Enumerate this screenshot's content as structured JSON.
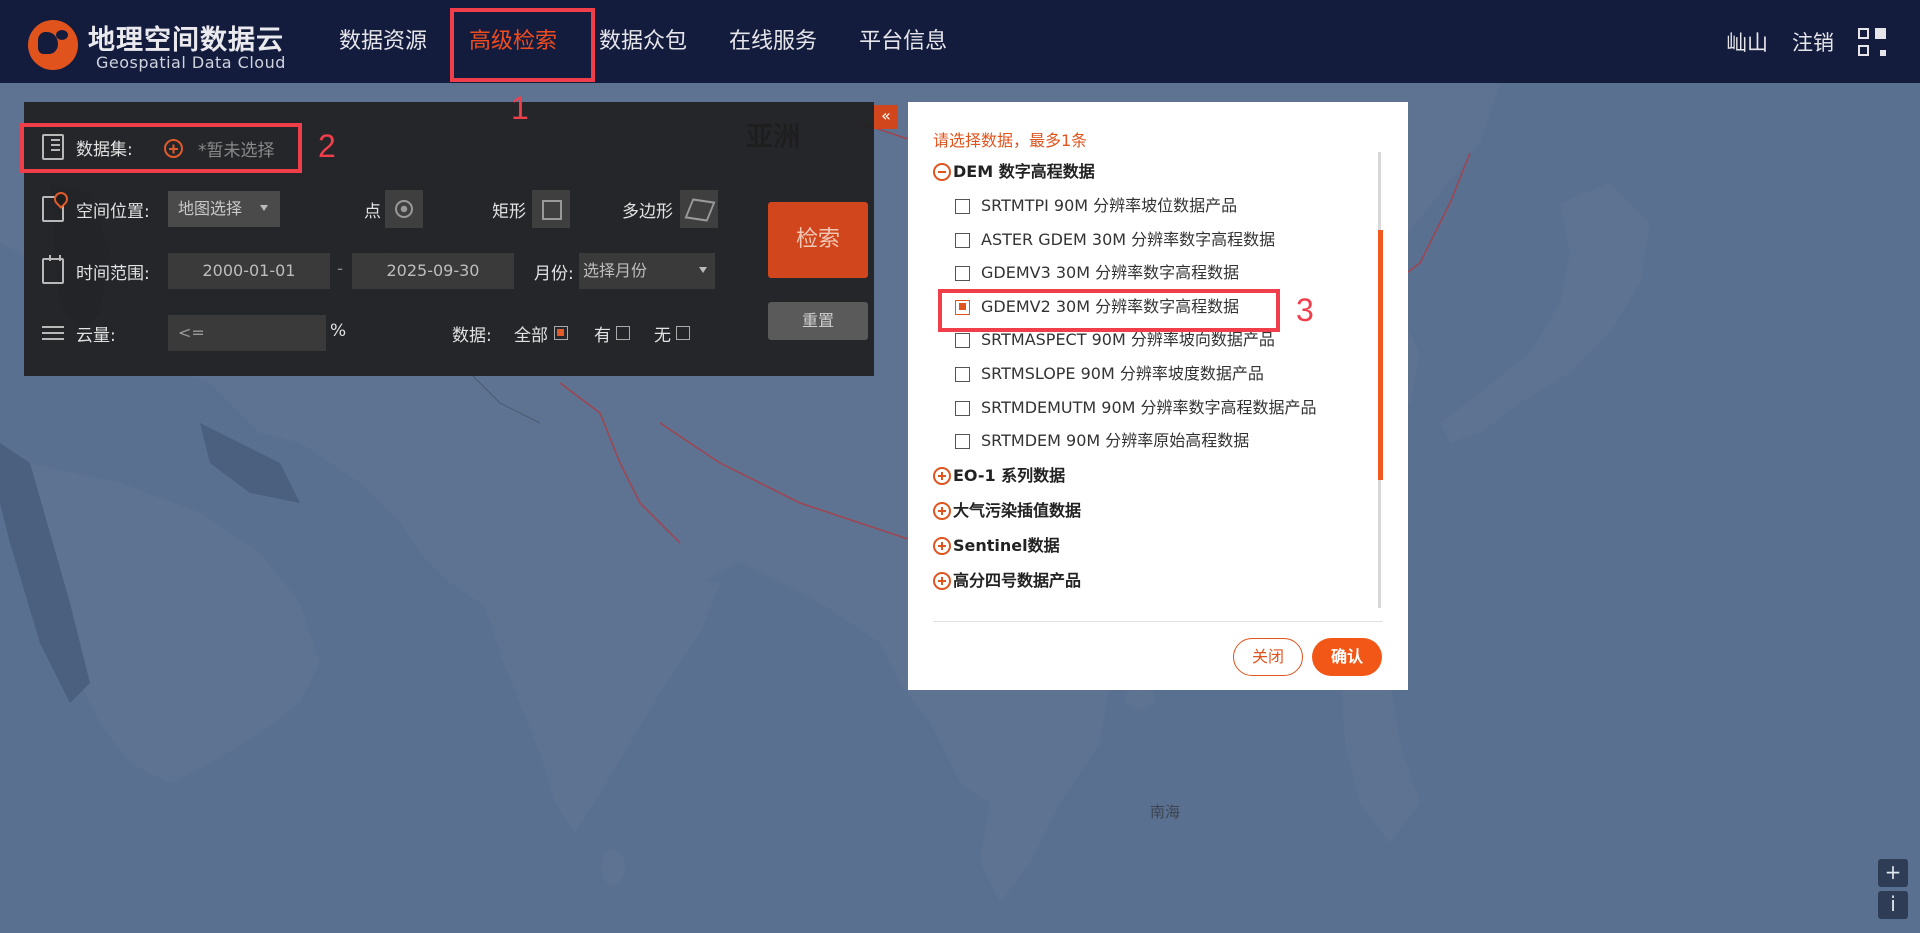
{
  "header": {
    "logo_cn": "地理空间数据云",
    "logo_en": "Geospatial Data Cloud",
    "nav": [
      {
        "label": "数据资源"
      },
      {
        "label": "高级检索",
        "active": true
      },
      {
        "label": "数据众包"
      },
      {
        "label": "在线服务"
      },
      {
        "label": "平台信息"
      }
    ],
    "user_name": "屾山",
    "logout": "注销",
    "accent_color": "#f04c1f"
  },
  "map": {
    "region_label": "亚洲",
    "sea_label": "南海",
    "zoom_in": "+",
    "info": "i"
  },
  "search_panel": {
    "dataset_label": "数据集:",
    "dataset_placeholder": "*暂未选择",
    "location_label": "空间位置:",
    "location_select": "地图选择",
    "point_label": "点",
    "rect_label": "矩形",
    "polygon_label": "多边形",
    "time_label": "时间范围:",
    "start_date": "2000-01-01",
    "date_sep": "-",
    "end_date": "2025-09-30",
    "month_label": "月份:",
    "month_select": "选择月份",
    "cloud_label": "云量:",
    "cloud_placeholder": "<=",
    "cloud_unit": "%",
    "data_label": "数据:",
    "data_options": [
      {
        "label": "全部",
        "checked": true
      },
      {
        "label": "有",
        "checked": false
      },
      {
        "label": "无",
        "checked": false
      }
    ],
    "search_button": "检索",
    "reset_button": "重置",
    "collapse": "«"
  },
  "annotations": [
    "1",
    "2",
    "3"
  ],
  "dataset_modal": {
    "hint": "请选择数据，最多1条",
    "groups": [
      {
        "label": "DEM 数字高程数据",
        "expanded": true,
        "items": [
          {
            "label": "SRTMTPI 90M 分辨率坡位数据产品",
            "checked": false
          },
          {
            "label": "ASTER GDEM 30M 分辨率数字高程数据",
            "checked": false
          },
          {
            "label": "GDEMV3 30M 分辨率数字高程数据",
            "checked": false
          },
          {
            "label": "GDEMV2 30M 分辨率数字高程数据",
            "checked": true
          },
          {
            "label": "SRTMASPECT 90M 分辨率坡向数据产品",
            "checked": false
          },
          {
            "label": "SRTMSLOPE 90M 分辨率坡度数据产品",
            "checked": false
          },
          {
            "label": "SRTMDEMUTM 90M 分辨率数字高程数据产品",
            "checked": false
          },
          {
            "label": "SRTMDEM 90M 分辨率原始高程数据",
            "checked": false
          }
        ]
      },
      {
        "label": "EO-1 系列数据",
        "expanded": false
      },
      {
        "label": "大气污染插值数据",
        "expanded": false
      },
      {
        "label": "Sentinel数据",
        "expanded": false
      },
      {
        "label": "高分四号数据产品",
        "expanded": false
      }
    ],
    "close_button": "关闭",
    "confirm_button": "确认"
  }
}
